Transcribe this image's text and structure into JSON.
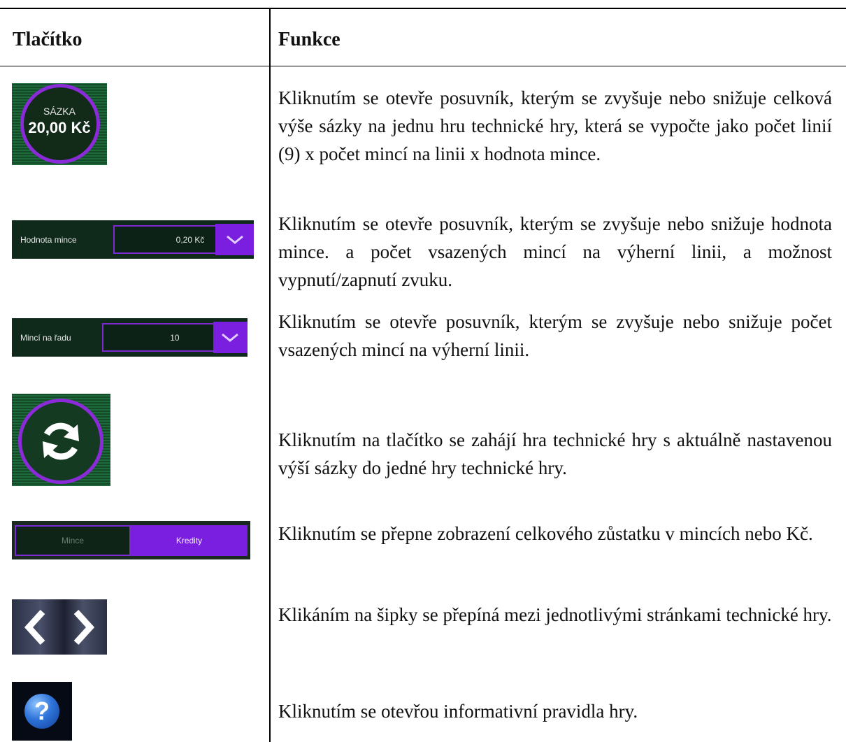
{
  "table": {
    "header": {
      "button": "Tlačítko",
      "function": "Funkce"
    },
    "rows": [
      {
        "icon": "bet-amount-circle",
        "icon_text": {
          "label": "SÁZKA",
          "value": "20,00 Kč"
        },
        "description": "Kliknutím se otevře posuvník, kterým se zvyšuje nebo snižuje celková výše sázky na jednu hru technické hry, která se vypočte jako počet linií (9) x počet mincí na linii x hodnota mince."
      },
      {
        "icon": "coin-value-slider",
        "icon_text": {
          "label": "Hodnota mince",
          "value": "0,20 Kč"
        },
        "description": "Kliknutím se otevře posuvník, kterým se zvyšuje nebo snižuje hodnota mince. a počet vsazených mincí na výherní linii, a možnost vypnutí/zapnutí zvuku."
      },
      {
        "icon": "coins-per-line-slider",
        "icon_text": {
          "label": "Mincí na řadu",
          "value": "10"
        },
        "description": "Kliknutím se otevře posuvník, kterým se zvyšuje nebo snižuje počet vsazených mincí na výherní linii."
      },
      {
        "icon": "spin-refresh",
        "description": "Kliknutím na tlačítko se zahájí hra technické hry s aktuálně nastavenou výší sázky do jedné hry technické hry."
      },
      {
        "icon": "coins-credits-toggle",
        "icon_text": {
          "left": "Mince",
          "right": "Kredity"
        },
        "description": "Kliknutím se přepne zobrazení celkového zůstatku v mincích nebo Kč."
      },
      {
        "icon": "page-arrows",
        "description": "Klikáním na šipky se přepíná mezi jednotlivými stránkami technické hry."
      },
      {
        "icon": "help-question",
        "icon_text": {
          "symbol": "?"
        },
        "description": "Kliknutím se otevřou informativní pravidla hry."
      }
    ]
  },
  "colors": {
    "felt_green": "#1f6a3a",
    "accent_purple": "#7a1fe0",
    "dark_panel": "#0f2a1b"
  }
}
